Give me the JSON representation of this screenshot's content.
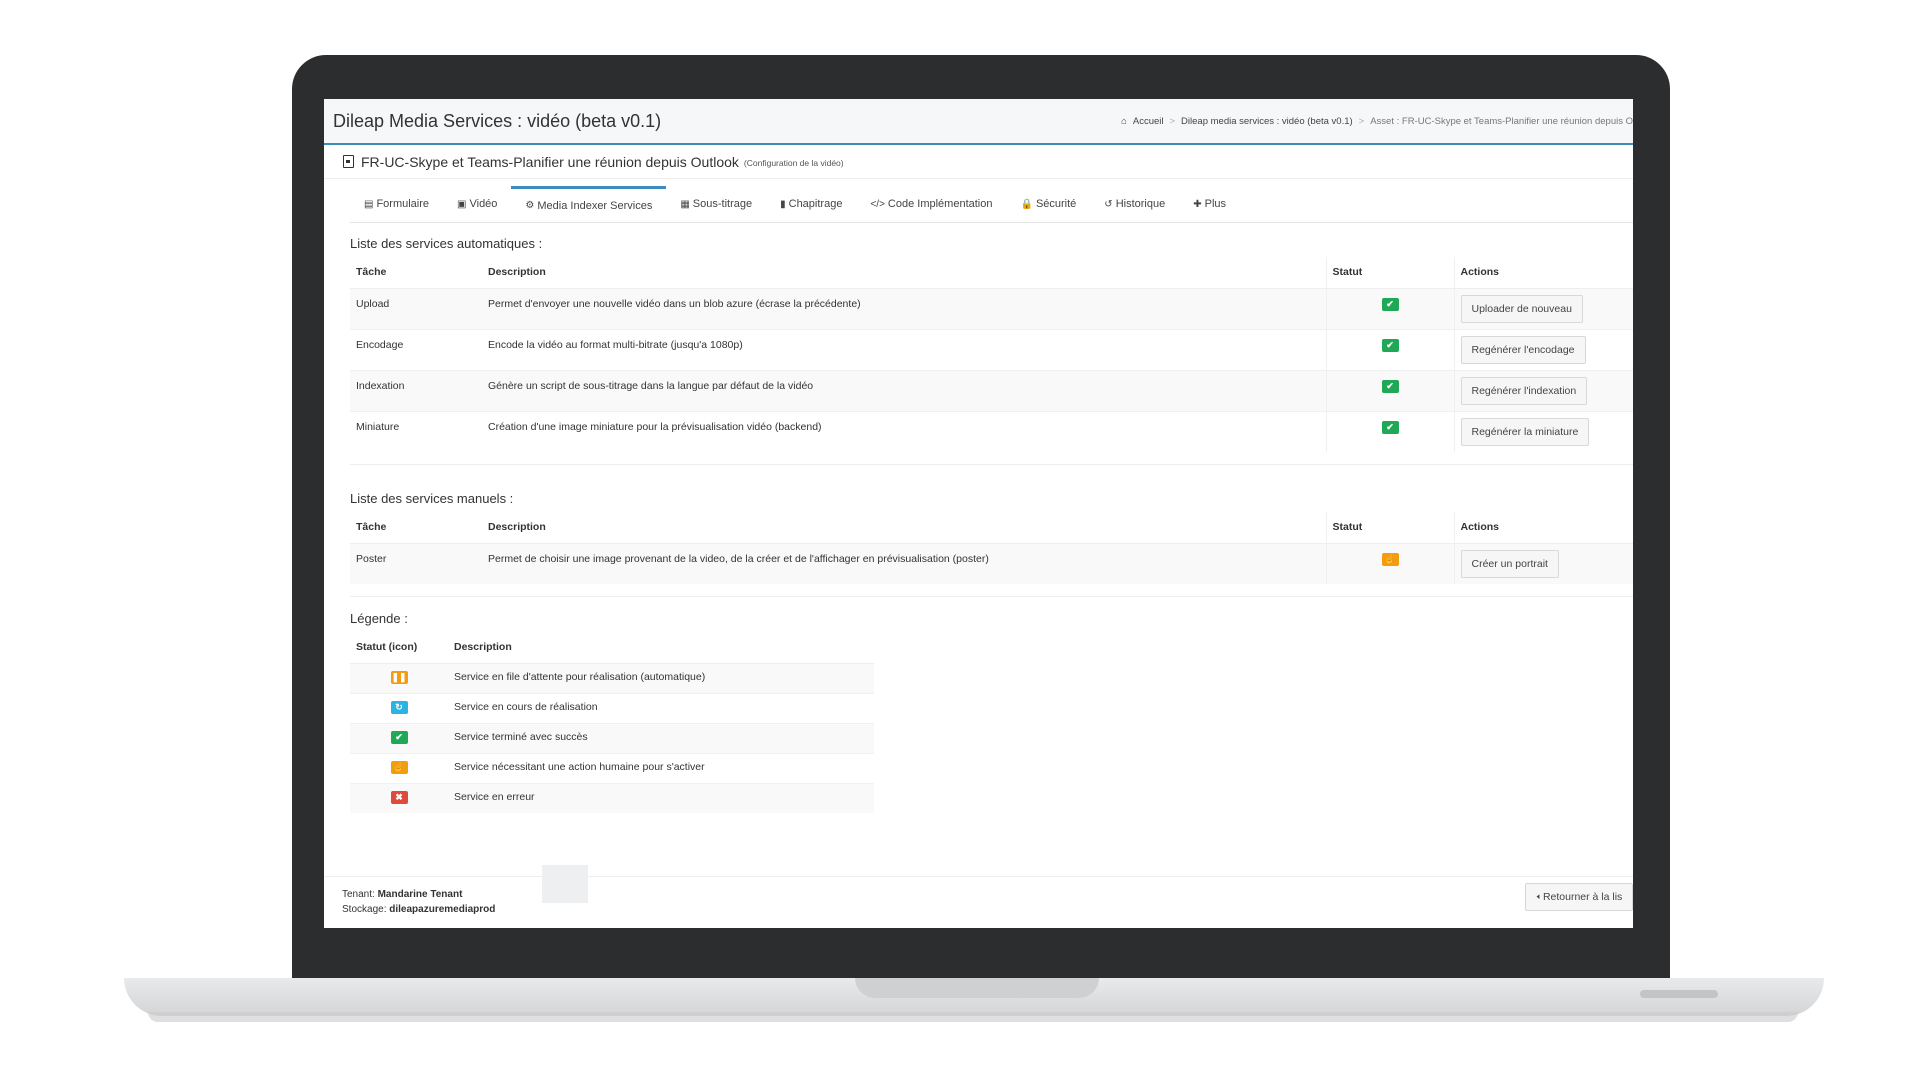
{
  "app": {
    "title": "Dileap Media Services : vidéo (beta v0.1)"
  },
  "breadcrumb": {
    "home": "Accueil",
    "section": "Dileap media services : vidéo (beta v0.1)",
    "current": "Asset : FR-UC-Skype et Teams-Planifier une réunion depuis O"
  },
  "page": {
    "title": "FR-UC-Skype et Teams-Planifier une réunion depuis Outlook",
    "subtitle": "(Configuration de la vidéo)"
  },
  "tabs": [
    {
      "icon": "▤",
      "label": "Formulaire"
    },
    {
      "icon": "▣",
      "label": "Vidéo"
    },
    {
      "icon": "⚙",
      "label": "Media Indexer Services"
    },
    {
      "icon": "▦",
      "label": "Sous-titrage"
    },
    {
      "icon": "▮",
      "label": "Chapitrage"
    },
    {
      "icon": "</>",
      "label": "Code Implémentation"
    },
    {
      "icon": "🔒",
      "label": "Sécurité"
    },
    {
      "icon": "↺",
      "label": "Historique"
    },
    {
      "icon": "✚",
      "label": "Plus"
    }
  ],
  "auto_services": {
    "title": "Liste des services automatiques :",
    "headers": {
      "task": "Tâche",
      "description": "Description",
      "status": "Statut",
      "actions": "Actions"
    },
    "rows": [
      {
        "task": "Upload",
        "description": "Permet d'envoyer une nouvelle vidéo dans un blob azure (écrase la précédente)",
        "status_icon": "check-icon",
        "action": "Uploader de nouveau"
      },
      {
        "task": "Encodage",
        "description": "Encode la vidéo au format multi-bitrate (jusqu'a 1080p)",
        "status_icon": "check-icon",
        "action": "Regénérer l'encodage"
      },
      {
        "task": "Indexation",
        "description": "Génère un script de sous-titrage dans la langue par défaut de la vidéo",
        "status_icon": "check-icon",
        "action": "Regénérer l'indexation"
      },
      {
        "task": "Miniature",
        "description": "Création d'une image miniature pour la prévisualisation vidéo (backend)",
        "status_icon": "check-icon",
        "action": "Regénérer la miniature"
      }
    ]
  },
  "manual_services": {
    "title": "Liste des services manuels :",
    "headers": {
      "task": "Tâche",
      "description": "Description",
      "status": "Statut",
      "actions": "Actions"
    },
    "rows": [
      {
        "task": "Poster",
        "description": "Permet de choisir une image provenant de la video, de la créer et de l'affichager en prévisualisation (poster)",
        "status_icon": "hand-icon",
        "action": "Créer un portrait"
      }
    ]
  },
  "legend": {
    "title": "Légende :",
    "headers": {
      "icon": "Statut (icon)",
      "description": "Description"
    },
    "rows": [
      {
        "icon": "pause-icon",
        "color": "#f39c12",
        "description": "Service en file d'attente pour réalisation (automatique)"
      },
      {
        "icon": "refresh-icon",
        "color": "#2bb3e3",
        "description": "Service en cours de réalisation"
      },
      {
        "icon": "check-icon",
        "color": "#1fa855",
        "description": "Service terminé avec succès"
      },
      {
        "icon": "hand-icon",
        "color": "#f39c12",
        "description": "Service nécessitant une action humaine pour s'activer"
      },
      {
        "icon": "close-icon",
        "color": "#dd4b39",
        "description": "Service en erreur"
      }
    ]
  },
  "footer": {
    "tenant_label": "Tenant:",
    "tenant_value": "Mandarine Tenant",
    "storage_label": "Stockage:",
    "storage_value": "dileapazuremediaprod",
    "back_label": "Retourner à la lis"
  },
  "colors": {
    "accent": "#3c8dbc",
    "success": "#1fa855",
    "warning": "#f39c12",
    "info": "#2bb3e3",
    "danger": "#dd4b39"
  }
}
